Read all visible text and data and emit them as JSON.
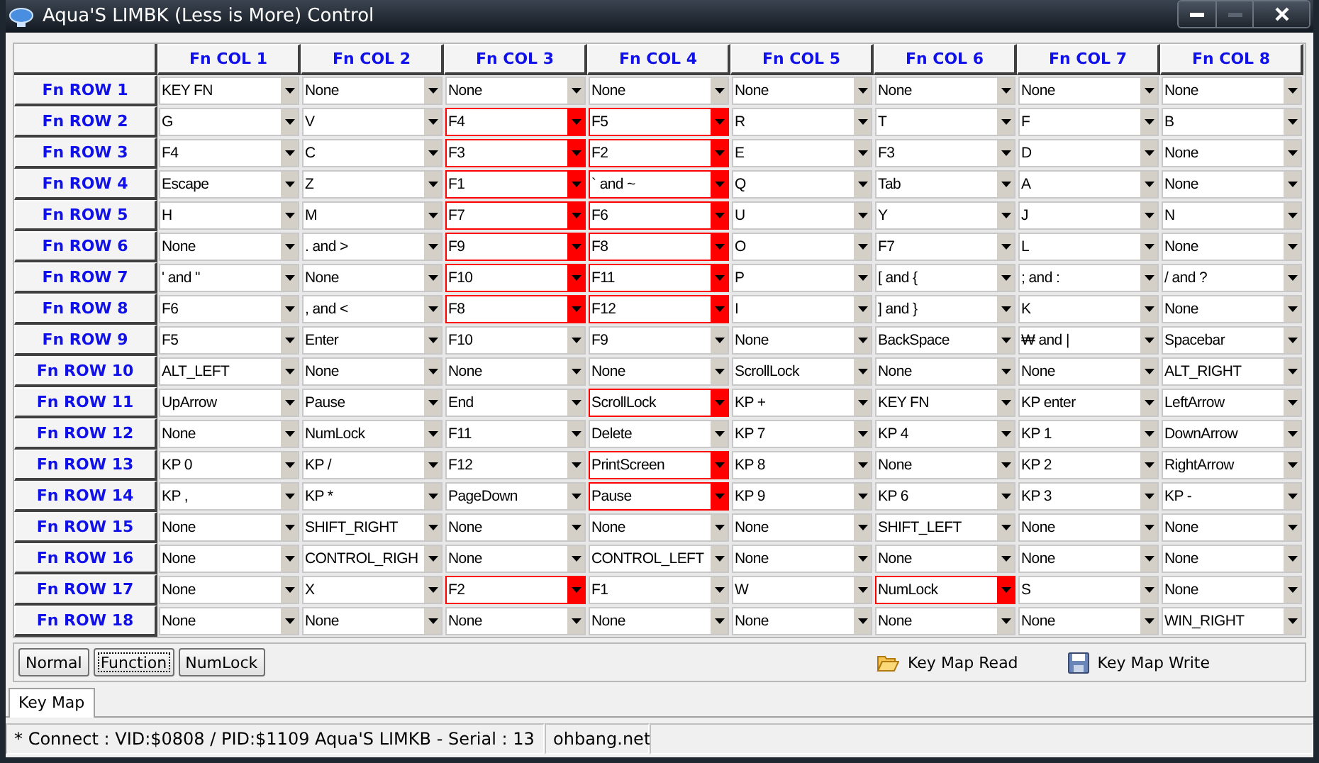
{
  "window": {
    "title": "Aqua'S LIMBK (Less is More) Control"
  },
  "columns": [
    "Fn COL 1",
    "Fn COL 2",
    "Fn COL 3",
    "Fn COL 4",
    "Fn COL 5",
    "Fn COL 6",
    "Fn COL 7",
    "Fn COL 8"
  ],
  "rows": [
    {
      "label": "Fn ROW 1",
      "cells": [
        {
          "value": "KEY FN",
          "highlighted": false
        },
        {
          "value": "None",
          "highlighted": false
        },
        {
          "value": "None",
          "highlighted": false
        },
        {
          "value": "None",
          "highlighted": false
        },
        {
          "value": "None",
          "highlighted": false
        },
        {
          "value": "None",
          "highlighted": false
        },
        {
          "value": "None",
          "highlighted": false
        },
        {
          "value": "None",
          "highlighted": false
        }
      ]
    },
    {
      "label": "Fn ROW 2",
      "cells": [
        {
          "value": "G",
          "highlighted": false
        },
        {
          "value": "V",
          "highlighted": false
        },
        {
          "value": "F4",
          "highlighted": true
        },
        {
          "value": "F5",
          "highlighted": true
        },
        {
          "value": "R",
          "highlighted": false
        },
        {
          "value": "T",
          "highlighted": false
        },
        {
          "value": "F",
          "highlighted": false
        },
        {
          "value": "B",
          "highlighted": false
        }
      ]
    },
    {
      "label": "Fn ROW 3",
      "cells": [
        {
          "value": "F4",
          "highlighted": false
        },
        {
          "value": "C",
          "highlighted": false
        },
        {
          "value": "F3",
          "highlighted": true
        },
        {
          "value": "F2",
          "highlighted": true
        },
        {
          "value": "E",
          "highlighted": false
        },
        {
          "value": "F3",
          "highlighted": false
        },
        {
          "value": "D",
          "highlighted": false
        },
        {
          "value": "None",
          "highlighted": false
        }
      ]
    },
    {
      "label": "Fn ROW 4",
      "cells": [
        {
          "value": "Escape",
          "highlighted": false
        },
        {
          "value": "Z",
          "highlighted": false
        },
        {
          "value": "F1",
          "highlighted": true
        },
        {
          "value": "` and ~",
          "highlighted": true
        },
        {
          "value": "Q",
          "highlighted": false
        },
        {
          "value": "Tab",
          "highlighted": false
        },
        {
          "value": "A",
          "highlighted": false
        },
        {
          "value": "None",
          "highlighted": false
        }
      ]
    },
    {
      "label": "Fn ROW 5",
      "cells": [
        {
          "value": "H",
          "highlighted": false
        },
        {
          "value": "M",
          "highlighted": false
        },
        {
          "value": "F7",
          "highlighted": true
        },
        {
          "value": "F6",
          "highlighted": true
        },
        {
          "value": "U",
          "highlighted": false
        },
        {
          "value": "Y",
          "highlighted": false
        },
        {
          "value": "J",
          "highlighted": false
        },
        {
          "value": "N",
          "highlighted": false
        }
      ]
    },
    {
      "label": "Fn ROW 6",
      "cells": [
        {
          "value": "None",
          "highlighted": false
        },
        {
          "value": ". and >",
          "highlighted": false
        },
        {
          "value": "F9",
          "highlighted": true
        },
        {
          "value": "F8",
          "highlighted": true
        },
        {
          "value": "O",
          "highlighted": false
        },
        {
          "value": "F7",
          "highlighted": false
        },
        {
          "value": "L",
          "highlighted": false
        },
        {
          "value": "None",
          "highlighted": false
        }
      ]
    },
    {
      "label": "Fn ROW 7",
      "cells": [
        {
          "value": "' and \"",
          "highlighted": false
        },
        {
          "value": "None",
          "highlighted": false
        },
        {
          "value": "F10",
          "highlighted": true
        },
        {
          "value": "F11",
          "highlighted": true
        },
        {
          "value": "P",
          "highlighted": false
        },
        {
          "value": "[ and {",
          "highlighted": false
        },
        {
          "value": "; and :",
          "highlighted": false
        },
        {
          "value": "/ and ?",
          "highlighted": false
        }
      ]
    },
    {
      "label": "Fn ROW 8",
      "cells": [
        {
          "value": "F6",
          "highlighted": false
        },
        {
          "value": ", and <",
          "highlighted": false
        },
        {
          "value": "F8",
          "highlighted": true
        },
        {
          "value": "F12",
          "highlighted": true
        },
        {
          "value": "I",
          "highlighted": false
        },
        {
          "value": "] and }",
          "highlighted": false
        },
        {
          "value": "K",
          "highlighted": false
        },
        {
          "value": "None",
          "highlighted": false
        }
      ]
    },
    {
      "label": "Fn ROW 9",
      "cells": [
        {
          "value": "F5",
          "highlighted": false
        },
        {
          "value": "Enter",
          "highlighted": false
        },
        {
          "value": "F10",
          "highlighted": false
        },
        {
          "value": "F9",
          "highlighted": false
        },
        {
          "value": "None",
          "highlighted": false
        },
        {
          "value": "BackSpace",
          "highlighted": false
        },
        {
          "value": "₩ and |",
          "highlighted": false
        },
        {
          "value": "Spacebar",
          "highlighted": false
        }
      ]
    },
    {
      "label": "Fn ROW 10",
      "cells": [
        {
          "value": "ALT_LEFT",
          "highlighted": false
        },
        {
          "value": "None",
          "highlighted": false
        },
        {
          "value": "None",
          "highlighted": false
        },
        {
          "value": "None",
          "highlighted": false
        },
        {
          "value": "ScrollLock",
          "highlighted": false
        },
        {
          "value": "None",
          "highlighted": false
        },
        {
          "value": "None",
          "highlighted": false
        },
        {
          "value": "ALT_RIGHT",
          "highlighted": false
        }
      ]
    },
    {
      "label": "Fn ROW 11",
      "cells": [
        {
          "value": "UpArrow",
          "highlighted": false
        },
        {
          "value": "Pause",
          "highlighted": false
        },
        {
          "value": "End",
          "highlighted": false
        },
        {
          "value": "ScrollLock",
          "highlighted": true
        },
        {
          "value": "KP +",
          "highlighted": false
        },
        {
          "value": "KEY FN",
          "highlighted": false
        },
        {
          "value": "KP enter",
          "highlighted": false
        },
        {
          "value": "LeftArrow",
          "highlighted": false
        }
      ]
    },
    {
      "label": "Fn ROW 12",
      "cells": [
        {
          "value": "None",
          "highlighted": false
        },
        {
          "value": "NumLock",
          "highlighted": false
        },
        {
          "value": "F11",
          "highlighted": false
        },
        {
          "value": "Delete",
          "highlighted": false
        },
        {
          "value": "KP 7",
          "highlighted": false
        },
        {
          "value": "KP 4",
          "highlighted": false
        },
        {
          "value": "KP 1",
          "highlighted": false
        },
        {
          "value": "DownArrow",
          "highlighted": false
        }
      ]
    },
    {
      "label": "Fn ROW 13",
      "cells": [
        {
          "value": "KP 0",
          "highlighted": false
        },
        {
          "value": "KP /",
          "highlighted": false
        },
        {
          "value": "F12",
          "highlighted": false
        },
        {
          "value": "PrintScreen",
          "highlighted": true
        },
        {
          "value": "KP 8",
          "highlighted": false
        },
        {
          "value": "None",
          "highlighted": false
        },
        {
          "value": "KP 2",
          "highlighted": false
        },
        {
          "value": "RightArrow",
          "highlighted": false
        }
      ]
    },
    {
      "label": "Fn ROW 14",
      "cells": [
        {
          "value": "KP ,",
          "highlighted": false
        },
        {
          "value": "KP *",
          "highlighted": false
        },
        {
          "value": "PageDown",
          "highlighted": false
        },
        {
          "value": "Pause",
          "highlighted": true
        },
        {
          "value": "KP 9",
          "highlighted": false
        },
        {
          "value": "KP 6",
          "highlighted": false
        },
        {
          "value": "KP 3",
          "highlighted": false
        },
        {
          "value": "KP -",
          "highlighted": false
        }
      ]
    },
    {
      "label": "Fn ROW 15",
      "cells": [
        {
          "value": "None",
          "highlighted": false
        },
        {
          "value": "SHIFT_RIGHT",
          "highlighted": false
        },
        {
          "value": "None",
          "highlighted": false
        },
        {
          "value": "None",
          "highlighted": false
        },
        {
          "value": "None",
          "highlighted": false
        },
        {
          "value": "SHIFT_LEFT",
          "highlighted": false
        },
        {
          "value": "None",
          "highlighted": false
        },
        {
          "value": "None",
          "highlighted": false
        }
      ]
    },
    {
      "label": "Fn ROW 16",
      "cells": [
        {
          "value": "None",
          "highlighted": false
        },
        {
          "value": "CONTROL_RIGH",
          "highlighted": false
        },
        {
          "value": "None",
          "highlighted": false
        },
        {
          "value": "CONTROL_LEFT",
          "highlighted": false
        },
        {
          "value": "None",
          "highlighted": false
        },
        {
          "value": "None",
          "highlighted": false
        },
        {
          "value": "None",
          "highlighted": false
        },
        {
          "value": "None",
          "highlighted": false
        }
      ]
    },
    {
      "label": "Fn ROW 17",
      "cells": [
        {
          "value": "None",
          "highlighted": false
        },
        {
          "value": "X",
          "highlighted": false
        },
        {
          "value": "F2",
          "highlighted": true
        },
        {
          "value": "F1",
          "highlighted": false
        },
        {
          "value": "W",
          "highlighted": false
        },
        {
          "value": "NumLock",
          "highlighted": true
        },
        {
          "value": "S",
          "highlighted": false
        },
        {
          "value": "None",
          "highlighted": false
        }
      ]
    },
    {
      "label": "Fn ROW 18",
      "cells": [
        {
          "value": "None",
          "highlighted": false
        },
        {
          "value": "None",
          "highlighted": false
        },
        {
          "value": "None",
          "highlighted": false
        },
        {
          "value": "None",
          "highlighted": false
        },
        {
          "value": "None",
          "highlighted": false
        },
        {
          "value": "None",
          "highlighted": false
        },
        {
          "value": "None",
          "highlighted": false
        },
        {
          "value": "WIN_RIGHT",
          "highlighted": false
        }
      ]
    }
  ],
  "modes": [
    {
      "label": "Normal",
      "selected": false
    },
    {
      "label": "Function",
      "selected": true
    },
    {
      "label": "NumLock",
      "selected": false
    }
  ],
  "actions": [
    {
      "label": "Key Map Read",
      "kind": "read"
    },
    {
      "label": "Key Map Write",
      "kind": "write"
    }
  ],
  "tabs": [
    {
      "label": "Key Map",
      "selected": true
    }
  ],
  "status_bar": [
    "* Connect : VID:$0808 / PID:$1109 Aqua'S LIMKB - Serial : 13",
    "ohbang.net"
  ]
}
